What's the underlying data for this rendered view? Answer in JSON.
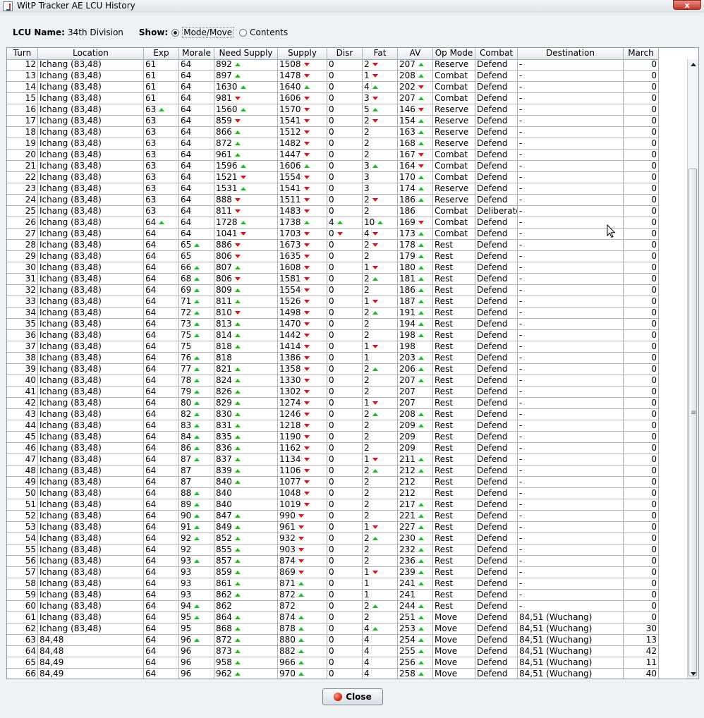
{
  "window": {
    "title": "WitP Tracker AE LCU History",
    "close_glyph": "x"
  },
  "header": {
    "lcu_label": "LCU Name:",
    "lcu_value": "34th Division",
    "show_label": "Show:",
    "option_mode": "Mode/Move",
    "option_contents": "Contents",
    "selected": "Mode/Move"
  },
  "table": {
    "columns": [
      "Turn",
      "Location",
      "Exp",
      "Morale",
      "Need Supply",
      "Supply",
      "Disr",
      "Fat",
      "AV",
      "Op Mode",
      "Combat",
      "Destination",
      "March"
    ],
    "rows": [
      [
        "12",
        "Ichang (83,48)",
        "61",
        "64",
        "892 up",
        "1508 down",
        "0",
        "2 down",
        "207 up",
        "Reserve",
        "Defend",
        "-",
        "0"
      ],
      [
        "13",
        "Ichang (83,48)",
        "61",
        "64",
        "897 up",
        "1478 down",
        "0",
        "1 down",
        "208 up",
        "Combat",
        "Defend",
        "-",
        "0"
      ],
      [
        "14",
        "Ichang (83,48)",
        "61",
        "64",
        "1630 up",
        "1640 up",
        "0",
        "4 up",
        "202 down",
        "Combat",
        "Defend",
        "-",
        "0"
      ],
      [
        "15",
        "Ichang (83,48)",
        "61",
        "64",
        "981 down",
        "1606 down",
        "0",
        "3 down",
        "207 up",
        "Combat",
        "Defend",
        "-",
        "0"
      ],
      [
        "16",
        "Ichang (83,48)",
        "63 up",
        "64",
        "1560 up",
        "1570 down",
        "0",
        "5 up",
        "146 down",
        "Reserve",
        "Defend",
        "-",
        "0"
      ],
      [
        "17",
        "Ichang (83,48)",
        "63",
        "64",
        "859 down",
        "1541 down",
        "0",
        "2 down",
        "154 up",
        "Reserve",
        "Defend",
        "-",
        "0"
      ],
      [
        "18",
        "Ichang (83,48)",
        "63",
        "64",
        "866 up",
        "1512 down",
        "0",
        "2",
        "163 up",
        "Reserve",
        "Defend",
        "-",
        "0"
      ],
      [
        "19",
        "Ichang (83,48)",
        "63",
        "64",
        "872 up",
        "1482 down",
        "0",
        "2",
        "168 up",
        "Reserve",
        "Defend",
        "-",
        "0"
      ],
      [
        "20",
        "Ichang (83,48)",
        "63",
        "64",
        "961 up",
        "1447 down",
        "0",
        "2",
        "167 down",
        "Combat",
        "Defend",
        "-",
        "0"
      ],
      [
        "21",
        "Ichang (83,48)",
        "63",
        "64",
        "1596 up",
        "1606 up",
        "0",
        "3 up",
        "164 down",
        "Combat",
        "Defend",
        "-",
        "0"
      ],
      [
        "22",
        "Ichang (83,48)",
        "63",
        "64",
        "1521 down",
        "1554 down",
        "0",
        "3",
        "170 up",
        "Combat",
        "Defend",
        "-",
        "0"
      ],
      [
        "23",
        "Ichang (83,48)",
        "63",
        "64",
        "1531 up",
        "1541 down",
        "0",
        "3",
        "174 up",
        "Reserve",
        "Defend",
        "-",
        "0"
      ],
      [
        "24",
        "Ichang (83,48)",
        "63",
        "64",
        "888 down",
        "1511 down",
        "0",
        "2 down",
        "186 up",
        "Reserve",
        "Defend",
        "-",
        "0"
      ],
      [
        "25",
        "Ichang (83,48)",
        "63",
        "64",
        "811 down",
        "1483 down",
        "0",
        "2",
        "186",
        "Combat",
        "Deliberate",
        "-",
        "0"
      ],
      [
        "26",
        "Ichang (83,48)",
        "64 up",
        "64",
        "1728 up",
        "1738 up",
        "4 up",
        "10 up",
        "169 down",
        "Combat",
        "Defend",
        "-",
        "0"
      ],
      [
        "27",
        "Ichang (83,48)",
        "64",
        "64",
        "1041 down",
        "1703 down",
        "0 down",
        "4 down",
        "173 up",
        "Combat",
        "Defend",
        "-",
        "0"
      ],
      [
        "28",
        "Ichang (83,48)",
        "64",
        "65 up",
        "886 down",
        "1673 down",
        "0",
        "2 down",
        "178 up",
        "Rest",
        "Defend",
        "-",
        "0"
      ],
      [
        "29",
        "Ichang (83,48)",
        "64",
        "65",
        "806 down",
        "1635 down",
        "0",
        "2",
        "179 up",
        "Rest",
        "Defend",
        "-",
        "0"
      ],
      [
        "30",
        "Ichang (83,48)",
        "64",
        "66 up",
        "807 up",
        "1608 down",
        "0",
        "1 down",
        "180 up",
        "Rest",
        "Defend",
        "-",
        "0"
      ],
      [
        "31",
        "Ichang (83,48)",
        "64",
        "68 up",
        "806 down",
        "1581 down",
        "0",
        "2 up",
        "181 up",
        "Rest",
        "Defend",
        "-",
        "0"
      ],
      [
        "32",
        "Ichang (83,48)",
        "64",
        "69 up",
        "809 up",
        "1554 down",
        "0",
        "2",
        "186 up",
        "Rest",
        "Defend",
        "-",
        "0"
      ],
      [
        "33",
        "Ichang (83,48)",
        "64",
        "71 up",
        "811 up",
        "1526 down",
        "0",
        "1 down",
        "187 up",
        "Rest",
        "Defend",
        "-",
        "0"
      ],
      [
        "34",
        "Ichang (83,48)",
        "64",
        "72 up",
        "810 down",
        "1498 down",
        "0",
        "2 up",
        "191 up",
        "Rest",
        "Defend",
        "-",
        "0"
      ],
      [
        "35",
        "Ichang (83,48)",
        "64",
        "73 up",
        "813 up",
        "1470 down",
        "0",
        "2",
        "194 up",
        "Rest",
        "Defend",
        "-",
        "0"
      ],
      [
        "36",
        "Ichang (83,48)",
        "64",
        "75 up",
        "814 up",
        "1442 down",
        "0",
        "2",
        "198 up",
        "Rest",
        "Defend",
        "-",
        "0"
      ],
      [
        "37",
        "Ichang (83,48)",
        "64",
        "75",
        "818 up",
        "1414 down",
        "0",
        "1 down",
        "198",
        "Rest",
        "Defend",
        "-",
        "0"
      ],
      [
        "38",
        "Ichang (83,48)",
        "64",
        "76 up",
        "818",
        "1386 down",
        "0",
        "1",
        "203 up",
        "Rest",
        "Defend",
        "-",
        "0"
      ],
      [
        "39",
        "Ichang (83,48)",
        "64",
        "77 up",
        "821 up",
        "1358 down",
        "0",
        "2 up",
        "206 up",
        "Rest",
        "Defend",
        "-",
        "0"
      ],
      [
        "40",
        "Ichang (83,48)",
        "64",
        "78 up",
        "824 up",
        "1330 down",
        "0",
        "2",
        "207 up",
        "Rest",
        "Defend",
        "-",
        "0"
      ],
      [
        "41",
        "Ichang (83,48)",
        "64",
        "79 up",
        "826 up",
        "1302 down",
        "0",
        "2",
        "207",
        "Rest",
        "Defend",
        "-",
        "0"
      ],
      [
        "42",
        "Ichang (83,48)",
        "64",
        "80 up",
        "829 up",
        "1274 down",
        "0",
        "1 down",
        "207",
        "Rest",
        "Defend",
        "-",
        "0"
      ],
      [
        "43",
        "Ichang (83,48)",
        "64",
        "82 up",
        "830 up",
        "1246 down",
        "0",
        "2 up",
        "208 up",
        "Rest",
        "Defend",
        "-",
        "0"
      ],
      [
        "44",
        "Ichang (83,48)",
        "64",
        "83 up",
        "831 up",
        "1218 down",
        "0",
        "2",
        "209 up",
        "Rest",
        "Defend",
        "-",
        "0"
      ],
      [
        "45",
        "Ichang (83,48)",
        "64",
        "84 up",
        "835 up",
        "1190 down",
        "0",
        "2",
        "209",
        "Rest",
        "Defend",
        "-",
        "0"
      ],
      [
        "46",
        "Ichang (83,48)",
        "64",
        "86 up",
        "836 up",
        "1162 down",
        "0",
        "2",
        "209",
        "Rest",
        "Defend",
        "-",
        "0"
      ],
      [
        "47",
        "Ichang (83,48)",
        "64",
        "87 up",
        "837 up",
        "1134 down",
        "0",
        "1 down",
        "211 up",
        "Rest",
        "Defend",
        "-",
        "0"
      ],
      [
        "48",
        "Ichang (83,48)",
        "64",
        "87",
        "839 up",
        "1106 down",
        "0",
        "2 up",
        "212 up",
        "Rest",
        "Defend",
        "-",
        "0"
      ],
      [
        "49",
        "Ichang (83,48)",
        "64",
        "87",
        "840 up",
        "1077 down",
        "0",
        "2",
        "212",
        "Rest",
        "Defend",
        "-",
        "0"
      ],
      [
        "50",
        "Ichang (83,48)",
        "64",
        "88 up",
        "840",
        "1048 down",
        "0",
        "2",
        "212",
        "Rest",
        "Defend",
        "-",
        "0"
      ],
      [
        "51",
        "Ichang (83,48)",
        "64",
        "89 up",
        "840",
        "1019 down",
        "0",
        "2",
        "217 up",
        "Rest",
        "Defend",
        "-",
        "0"
      ],
      [
        "52",
        "Ichang (83,48)",
        "64",
        "90 up",
        "847 up",
        "990 down",
        "0",
        "2",
        "221 up",
        "Rest",
        "Defend",
        "-",
        "0"
      ],
      [
        "53",
        "Ichang (83,48)",
        "64",
        "91 up",
        "849 up",
        "961 down",
        "0",
        "1 down",
        "227 up",
        "Rest",
        "Defend",
        "-",
        "0"
      ],
      [
        "54",
        "Ichang (83,48)",
        "64",
        "92 up",
        "852 up",
        "932 down",
        "0",
        "2 up",
        "230 up",
        "Rest",
        "Defend",
        "-",
        "0"
      ],
      [
        "55",
        "Ichang (83,48)",
        "64",
        "92",
        "855 up",
        "903 down",
        "0",
        "2",
        "232 up",
        "Rest",
        "Defend",
        "-",
        "0"
      ],
      [
        "56",
        "Ichang (83,48)",
        "64",
        "93 up",
        "857 up",
        "874 down",
        "0",
        "2",
        "236 up",
        "Rest",
        "Defend",
        "-",
        "0"
      ],
      [
        "57",
        "Ichang (83,48)",
        "64",
        "93",
        "859 up",
        "869 down",
        "0",
        "1 down",
        "239 up",
        "Rest",
        "Defend",
        "-",
        "0"
      ],
      [
        "58",
        "Ichang (83,48)",
        "64",
        "93",
        "861 up",
        "871 up",
        "0",
        "1",
        "241 up",
        "Rest",
        "Defend",
        "-",
        "0"
      ],
      [
        "59",
        "Ichang (83,48)",
        "64",
        "93",
        "862 up",
        "872 up",
        "0",
        "1",
        "241",
        "Rest",
        "Defend",
        "-",
        "0"
      ],
      [
        "60",
        "Ichang (83,48)",
        "64",
        "94 up",
        "862",
        "872",
        "0",
        "2 up",
        "244 up",
        "Rest",
        "Defend",
        "-",
        "0"
      ],
      [
        "61",
        "Ichang (83,48)",
        "64",
        "95 up",
        "864 up",
        "874 up",
        "0",
        "2",
        "251 up",
        "Move",
        "Defend",
        "84,51 (Wuchang)",
        "0"
      ],
      [
        "62",
        "Ichang (83,48)",
        "64",
        "95",
        "868 up",
        "878 up",
        "0",
        "4 up",
        "253 up",
        "Move",
        "Defend",
        "84,51 (Wuchang)",
        "30"
      ],
      [
        "63",
        "84,48",
        "64",
        "96 up",
        "872 up",
        "880 up",
        "0",
        "4",
        "254 up",
        "Move",
        "Defend",
        "84,51 (Wuchang)",
        "13"
      ],
      [
        "64",
        "84,48",
        "64",
        "96",
        "873 up",
        "882 up",
        "0",
        "4",
        "255 up",
        "Move",
        "Defend",
        "84,51 (Wuchang)",
        "42"
      ],
      [
        "65",
        "84,49",
        "64",
        "96",
        "958 up",
        "966 up",
        "0",
        "4",
        "256 up",
        "Move",
        "Defend",
        "84,51 (Wuchang)",
        "11"
      ],
      [
        "66",
        "84,49",
        "64",
        "96",
        "962 up",
        "970 up",
        "0",
        "4",
        "258 up",
        "Move",
        "Defend",
        "84,51 (Wuchang)",
        "40"
      ]
    ]
  },
  "footer": {
    "close_label": "Close"
  },
  "colors": {
    "up_arrow": "#22bb22",
    "down_arrow": "#dd1111"
  },
  "icons": {
    "up": "triangle-up-green-icon",
    "down": "triangle-down-red-icon",
    "close": "stop-icon"
  }
}
